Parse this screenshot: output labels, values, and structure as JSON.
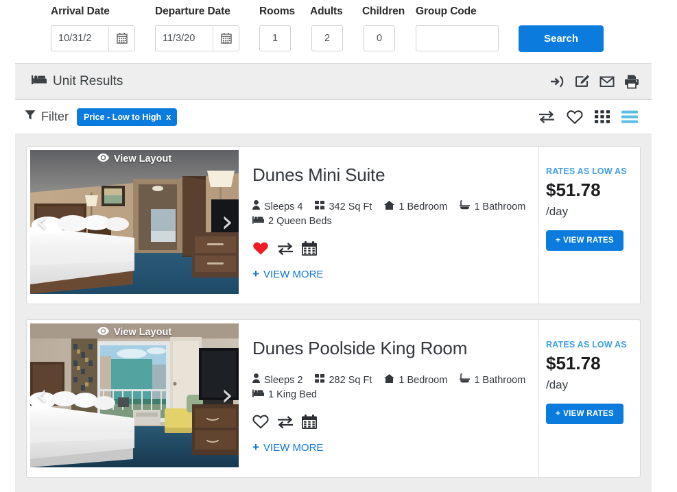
{
  "search": {
    "fields": [
      {
        "label": "Arrival Date",
        "value": "10/31/2",
        "type": "date",
        "name": "arrival-date"
      },
      {
        "label": "Departure Date",
        "value": "11/3/20",
        "type": "date",
        "name": "departure-date"
      },
      {
        "label": "Rooms",
        "value": "1",
        "type": "num",
        "name": "rooms"
      },
      {
        "label": "Adults",
        "value": "2",
        "type": "num",
        "name": "adults"
      },
      {
        "label": "Children",
        "value": "0",
        "type": "num",
        "name": "children"
      },
      {
        "label": "Group Code",
        "value": "",
        "type": "text",
        "name": "group-code"
      }
    ],
    "search_button": "Search"
  },
  "results_header": {
    "title": "Unit Results",
    "icons": [
      "sign-in-icon",
      "edit-icon",
      "envelope-icon",
      "print-icon"
    ]
  },
  "filter_bar": {
    "label": "Filter",
    "chip": {
      "text": "Price - Low to High",
      "remove": "x"
    },
    "view_icons": [
      "compare-icon",
      "heart-icon",
      "grid-view-icon",
      "list-view-icon"
    ],
    "active_view": "list-view-icon"
  },
  "units": [
    {
      "name": "Dunes Mini Suite",
      "view_layout": "View Layout",
      "specs": [
        {
          "icon": "person-icon",
          "text": "Sleeps 4"
        },
        {
          "icon": "squares-icon",
          "text": "342 Sq Ft"
        },
        {
          "icon": "home-icon",
          "text": "1 Bedroom"
        },
        {
          "icon": "bath-icon",
          "text": "1 Bathroom"
        },
        {
          "icon": "bed-icon",
          "text": "2 Queen Beds"
        }
      ],
      "favorited": true,
      "view_more": "VIEW MORE",
      "rates_label": "RATES AS LOW AS",
      "price": "$51.78",
      "per": "/day",
      "view_rates": "VIEW RATES"
    },
    {
      "name": "Dunes Poolside King Room",
      "view_layout": "View Layout",
      "specs": [
        {
          "icon": "person-icon",
          "text": "Sleeps 2"
        },
        {
          "icon": "squares-icon",
          "text": "282 Sq Ft"
        },
        {
          "icon": "home-icon",
          "text": "1 Bedroom"
        },
        {
          "icon": "bath-icon",
          "text": "1 Bathroom"
        },
        {
          "icon": "bed-icon",
          "text": "1 King Bed"
        }
      ],
      "favorited": false,
      "view_more": "VIEW MORE",
      "rates_label": "RATES AS LOW AS",
      "price": "$51.78",
      "per": "/day",
      "view_rates": "VIEW RATES"
    }
  ],
  "colors": {
    "accent_blue": "#0b7cdd",
    "link_blue": "#1273d4",
    "rates_blue": "#3f9fe0",
    "active_view_blue": "#5bbce4",
    "favorite_red": "#ee1c25",
    "bar_gray": "#eeeeee",
    "page_gray": "#ededee"
  }
}
